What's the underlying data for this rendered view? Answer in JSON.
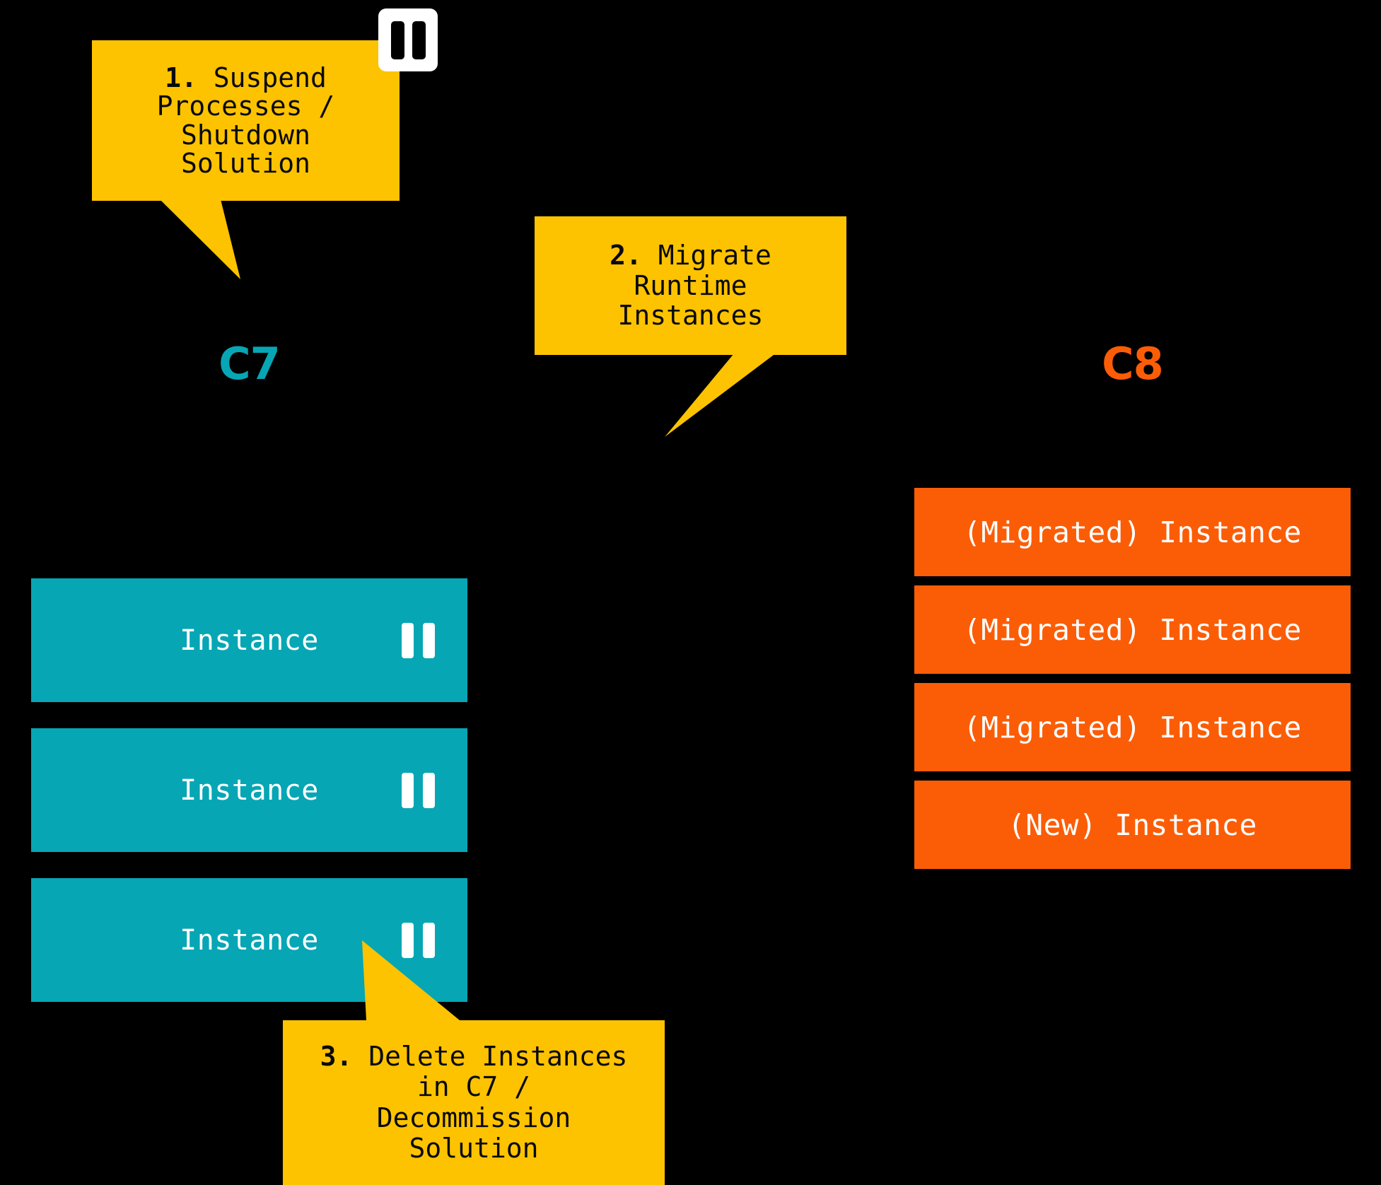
{
  "diagram": {
    "background_color": "#000000",
    "accent_yellow": "#FDC300",
    "teal": "#06A6B5",
    "orange": "#FB5D07"
  },
  "callouts": [
    {
      "id": "callout-1",
      "step_number": "1.",
      "text": " Suspend\nProcesses /\nShutdown\nSolution",
      "full_text": "1. Suspend Processes / Shutdown Solution"
    },
    {
      "id": "callout-2",
      "step_number": "2.",
      "text": " Migrate\nRuntime\nInstances",
      "full_text": "2. Migrate Runtime Instances"
    },
    {
      "id": "callout-3",
      "step_number": "3.",
      "text": " Delete Instances\nin C7 /\nDecommission\nSolution",
      "full_text": "3. Delete Instances in C7 / Decommission Solution"
    }
  ],
  "icons": {
    "pause_badge": "pause-icon",
    "pause_inline": "pause-icon"
  },
  "columns": {
    "left": {
      "label": "C7",
      "label_color": "#06A6B5",
      "bar_color": "#06A6B5",
      "instances": [
        {
          "label": "Instance",
          "has_pause_icon": true
        },
        {
          "label": "Instance",
          "has_pause_icon": true
        },
        {
          "label": "Instance",
          "has_pause_icon": true
        }
      ]
    },
    "right": {
      "label": "C8",
      "label_color": "#FB5D07",
      "bar_color": "#FB5D07",
      "instances": [
        {
          "label": "(Migrated) Instance",
          "has_pause_icon": false
        },
        {
          "label": "(Migrated) Instance",
          "has_pause_icon": false
        },
        {
          "label": "(Migrated) Instance",
          "has_pause_icon": false
        },
        {
          "label": "(New) Instance",
          "has_pause_icon": false
        }
      ]
    }
  }
}
